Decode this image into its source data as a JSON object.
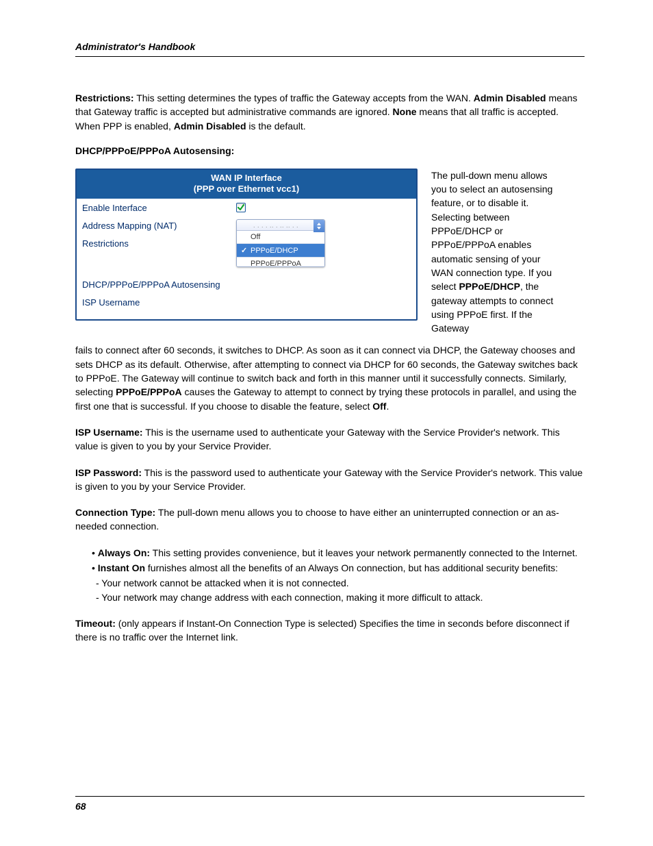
{
  "header": {
    "title": "Administrator's Handbook"
  },
  "restrictions": {
    "label": "Restrictions:",
    "text1": " This setting determines the types of traffic the Gateway accepts from the WAN. ",
    "b1": "Admin Disabled",
    "text2": " means that Gateway traffic is accepted but administrative commands are ignored. ",
    "b2": "None",
    "text3": " means that all traffic is accepted. When PPP is enabled, ",
    "b3": "Admin Disabled",
    "text4": " is the default."
  },
  "autosensing": {
    "heading": "DHCP/PPPoE/PPPoA Autosensing",
    "colon": ":",
    "figure": {
      "title1": "WAN IP Interface",
      "title2": "(PPP over Ethernet vcc1)",
      "rows": {
        "enable": "Enable Interface",
        "nat": "Address Mapping (NAT)",
        "restrictions": "Restrictions",
        "autosensing": "DHCP/PPPoE/PPPoA Autosensing",
        "isp_user": "ISP Username"
      },
      "dropdown": {
        "selected_partial": ". .   . .   .. .    ..   .. . .",
        "options": {
          "off": "Off",
          "pppoe_dhcp": "PPPoE/DHCP",
          "pppoe_pppoa": "PPPoE/PPPoA"
        }
      }
    },
    "wrap1": "The pull-down menu allows you to select an autosensing feature, or to disable it. Selecting between PPPoE/DHCP or PPPoE/PPPoA enables automatic sensing of your WAN connection type. If you select ",
    "wrap_b1": "PPPoE/DHCP",
    "wrap2": ", the gateway attempts to connect using PPPoE first. If the Gateway",
    "cont1": " fails to connect after 60 seconds, it switches to DHCP. As soon as it can connect via DHCP, the Gateway chooses and sets DHCP as its default. Otherwise, after attempting to connect via DHCP for 60 seconds, the Gateway switches back to PPPoE. The Gateway will continue to switch back and forth in this manner until it successfully connects. Similarly, selecting ",
    "cont_b1": "PPPoE/PPPoA",
    "cont2": " causes the Gateway to attempt to connect by trying these protocols in parallel, and using the first one that is successful. If you choose to disable the feature, select ",
    "cont_b2": "Off",
    "cont3": "."
  },
  "isp_username": {
    "label": "ISP Username:",
    "text": " This is the username used to authenticate your Gateway with the Service Provider's network. This value is given to you by your Service Provider."
  },
  "isp_password": {
    "label": "ISP Password:",
    "text": " This is the password used to authenticate your Gateway with the Service Provider's network. This value is given to you by your Service Provider."
  },
  "connection_type": {
    "label": "Connection Type:",
    "text": " The pull-down menu allows you to choose to have either an uninterrupted connection or an as-needed connection.",
    "always_on": {
      "bullet": "• ",
      "label": "Always On:",
      "text": " This setting provides convenience, but it leaves your network permanently connected to the Internet."
    },
    "instant_on": {
      "bullet": "• ",
      "label": "Instant On",
      "text": " furnishes almost all the benefits of an Always On connection, but has additional security benefits:",
      "sub1": " - Your network cannot be attacked when it is not connected.",
      "sub2": " - Your network may change address with each connection, making it more difficult to attack."
    }
  },
  "timeout": {
    "label": "Timeout:",
    "text": " (only appears if Instant-On Connection Type is selected) Specifies the time in seconds before disconnect if there is no traffic over the Internet link."
  },
  "footer": {
    "page": "68"
  }
}
